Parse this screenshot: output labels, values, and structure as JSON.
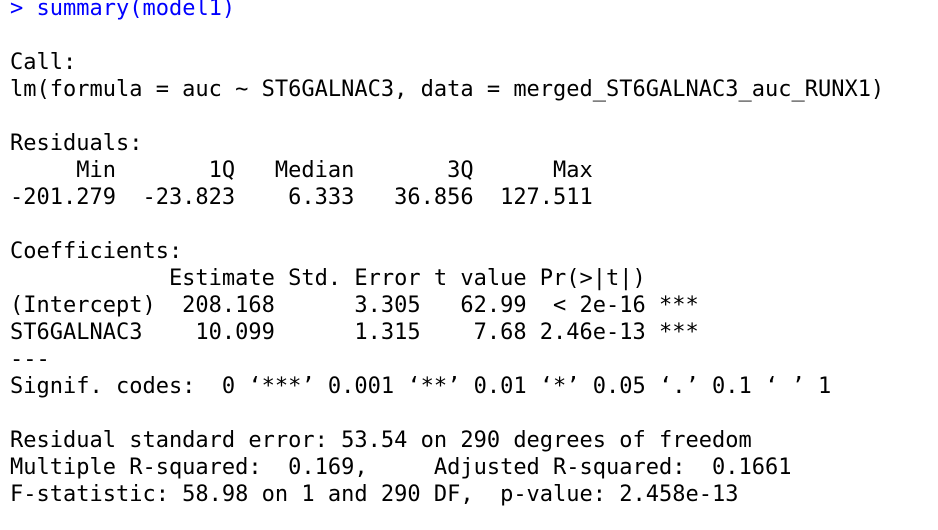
{
  "console": {
    "prompt": "> ",
    "command": "summary(model1)",
    "call_header": "Call:",
    "call_text": "lm(formula = auc ~ ST6GALNAC3, data = merged_ST6GALNAC3_auc_RUNX1)",
    "residuals_header": "Residuals:",
    "residuals_labels": "     Min       1Q   Median       3Q      Max ",
    "residuals_values": "-201.279  -23.823    6.333   36.856  127.511 ",
    "coefficients_header": "Coefficients:",
    "coef_header_row": "            Estimate Std. Error t value Pr(>|t|)    ",
    "coef_rows": [
      "(Intercept)  208.168      3.305   62.99  < 2e-16 ***",
      "ST6GALNAC3    10.099      1.315    7.68 2.46e-13 ***"
    ],
    "separator": "---",
    "signif_codes": "Signif. codes:  0 ‘***’ 0.001 ‘**’ 0.01 ‘*’ 0.05 ‘.’ 0.1 ‘ ’ 1",
    "rse_line": "Residual standard error: 53.54 on 290 degrees of freedom",
    "r2_line": "Multiple R-squared:  0.169,\tAdjusted R-squared:  0.1661 ",
    "f_line": "F-statistic: 58.98 on 1 and 290 DF,  p-value: 2.458e-13",
    "colors": {
      "prompt": "#0000ff",
      "output": "#000000",
      "background": "#ffffff"
    }
  }
}
